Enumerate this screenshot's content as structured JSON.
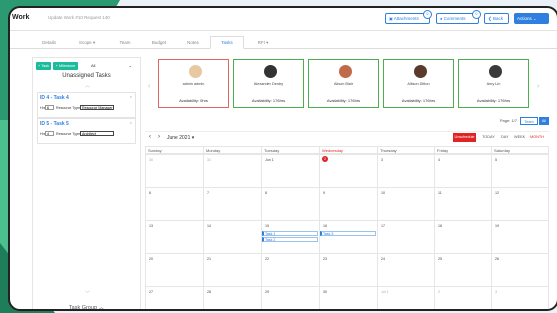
{
  "header": {
    "title": "Work",
    "subtitle": "Update Work #10 Request 140",
    "buttons": {
      "attachments": "Attachments",
      "comments": "Comments",
      "back": "Back",
      "actions": "Actions"
    },
    "badges": {
      "attachments": "0",
      "comments": "0"
    }
  },
  "tabs": [
    "Details",
    "Scope",
    "Team",
    "Budget",
    "Notes",
    "Tasks",
    "RFI"
  ],
  "active_tab": "Tasks",
  "left_panel": {
    "add_task": "+ Task",
    "add_milestone": "+ Milestone",
    "filter_value": "All",
    "title": "Unassigned Tasks",
    "tasks": [
      {
        "id": "ID 4 - Task 4",
        "hrs_label": "Hrs",
        "hrs": "6",
        "resource_label": "Resource Type",
        "resource": "Resource Manager"
      },
      {
        "id": "ID 5 - Task 5",
        "hrs_label": "Hrs",
        "hrs": "4",
        "resource_label": "Resource Type",
        "resource": "Architect"
      }
    ],
    "group_label": "Task Group"
  },
  "people": [
    {
      "name": "admin admin",
      "availability": "Availability: 0hrs",
      "border": "red",
      "face": "#e8c8a0"
    },
    {
      "name": "Alexander Dentry",
      "availability": "Availability: 176hrs",
      "border": "green",
      "face": "#333333"
    },
    {
      "name": "Alison Blair",
      "availability": "Availability: 176hrs",
      "border": "green",
      "face": "#c06a4a"
    },
    {
      "name": "Allison Ditton",
      "availability": "Availability: 176hrs",
      "border": "green",
      "face": "#5a3a2a"
    },
    {
      "name": "Amy Lin",
      "availability": "Availability: 176hrs",
      "border": "green",
      "face": "#3a3a3a"
    }
  ],
  "paging": {
    "label": "Page: 1/7",
    "team_label": "Team",
    "all_label": "All"
  },
  "calendar": {
    "month_label": "June 2021",
    "unschedule": "Unschedule",
    "views": {
      "today": "TODAY",
      "day": "DAY",
      "week": "WEEK",
      "month": "MONTH"
    },
    "weekdays": [
      "Sunday",
      "Monday",
      "Tuesday",
      "Wednesday",
      "Thursday",
      "Friday",
      "Saturday"
    ],
    "weeks": [
      [
        "30",
        "31",
        "Jun 1",
        "2",
        "3",
        "4",
        "5"
      ],
      [
        "6",
        "7",
        "8",
        "9",
        "10",
        "11",
        "12"
      ],
      [
        "13",
        "14",
        "15",
        "16",
        "17",
        "18",
        "19"
      ],
      [
        "20",
        "21",
        "22",
        "23",
        "24",
        "25",
        "26"
      ],
      [
        "27",
        "28",
        "29",
        "30",
        "Jul 1",
        "2",
        "3"
      ]
    ],
    "events": {
      "tue_1": "Task 1",
      "tue_2": "Task 2",
      "wed_1": "Task 3"
    }
  },
  "colors": {
    "accent": "#2f7fe0",
    "green": "#1abc9c",
    "danger": "#e02424"
  }
}
